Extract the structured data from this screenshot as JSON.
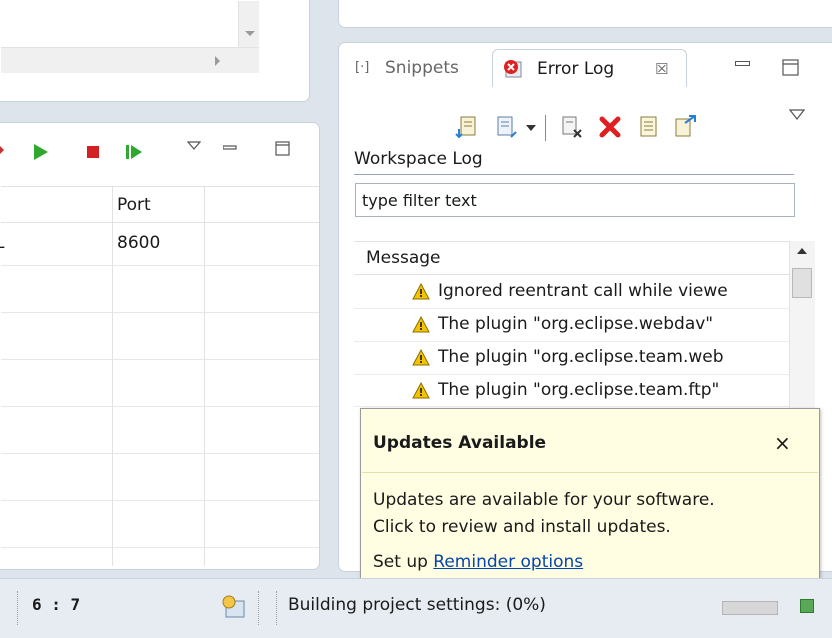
{
  "servers_view": {
    "columns": [
      "Port"
    ],
    "rows": [
      {
        "fragment": "L",
        "port": "8600"
      }
    ]
  },
  "error_log_view": {
    "tabs": [
      {
        "label": "Snippets",
        "icon": "snippets-icon"
      },
      {
        "label": "Error Log",
        "icon": "error-log-icon"
      }
    ],
    "log_label": "Workspace Log",
    "filter": {
      "value": "type filter text"
    },
    "column_header": "Message",
    "rows": [
      {
        "text": "Ignored reentrant call while viewe",
        "icon": "warning-icon"
      },
      {
        "text": "The plugin \"org.eclipse.webdav\"",
        "icon": "warning-icon"
      },
      {
        "text": "The plugin \"org.eclipse.team.web",
        "icon": "warning-icon"
      },
      {
        "text": "The plugin \"org.eclipse.team.ftp\"",
        "icon": "warning-icon"
      }
    ]
  },
  "updates_popup": {
    "title": "Updates Available",
    "close_label": "×",
    "body_line1": "Updates are available for your software.",
    "body_line2": "Click to review and install updates.",
    "setup_prefix": "Set up",
    "setup_link": "Reminder options"
  },
  "status_bar": {
    "cursor_position": "6 : 7",
    "progress_text": "Building project settings: (0%)"
  },
  "colors": {
    "run_green": "#2fa82f",
    "stop_red": "#d42020",
    "error_red": "#e02020",
    "warning_yellow": "#f5c400",
    "popup_bg": "#fffde2",
    "link_blue": "#0645ad"
  }
}
